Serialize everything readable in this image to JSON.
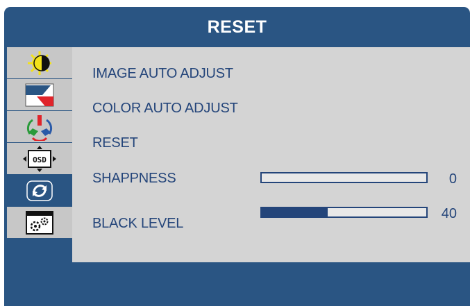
{
  "title": "RESET",
  "sidebar": {
    "tabs": [
      {
        "icon": "brightness-contrast-icon",
        "active": false
      },
      {
        "icon": "image-setup-icon",
        "active": false
      },
      {
        "icon": "color-temperature-icon",
        "active": false
      },
      {
        "icon": "osd-setup-icon",
        "active": false
      },
      {
        "icon": "reset-icon",
        "active": true
      },
      {
        "icon": "extra-settings-icon",
        "active": false
      }
    ]
  },
  "menu": {
    "image_auto_adjust": "IMAGE  AUTO  ADJUST",
    "color_auto_adjust": "COLOR  AUTO  ADJUST",
    "reset": "RESET",
    "sharpness": {
      "label": "SHAPPNESS",
      "value": "0",
      "level": 0
    },
    "black_level": {
      "label": "BLACK LEVEL",
      "value": "40",
      "level": 40
    }
  },
  "colors": {
    "frame": "#2a5583",
    "panel": "#d4d4d4",
    "text": "#24457a"
  }
}
